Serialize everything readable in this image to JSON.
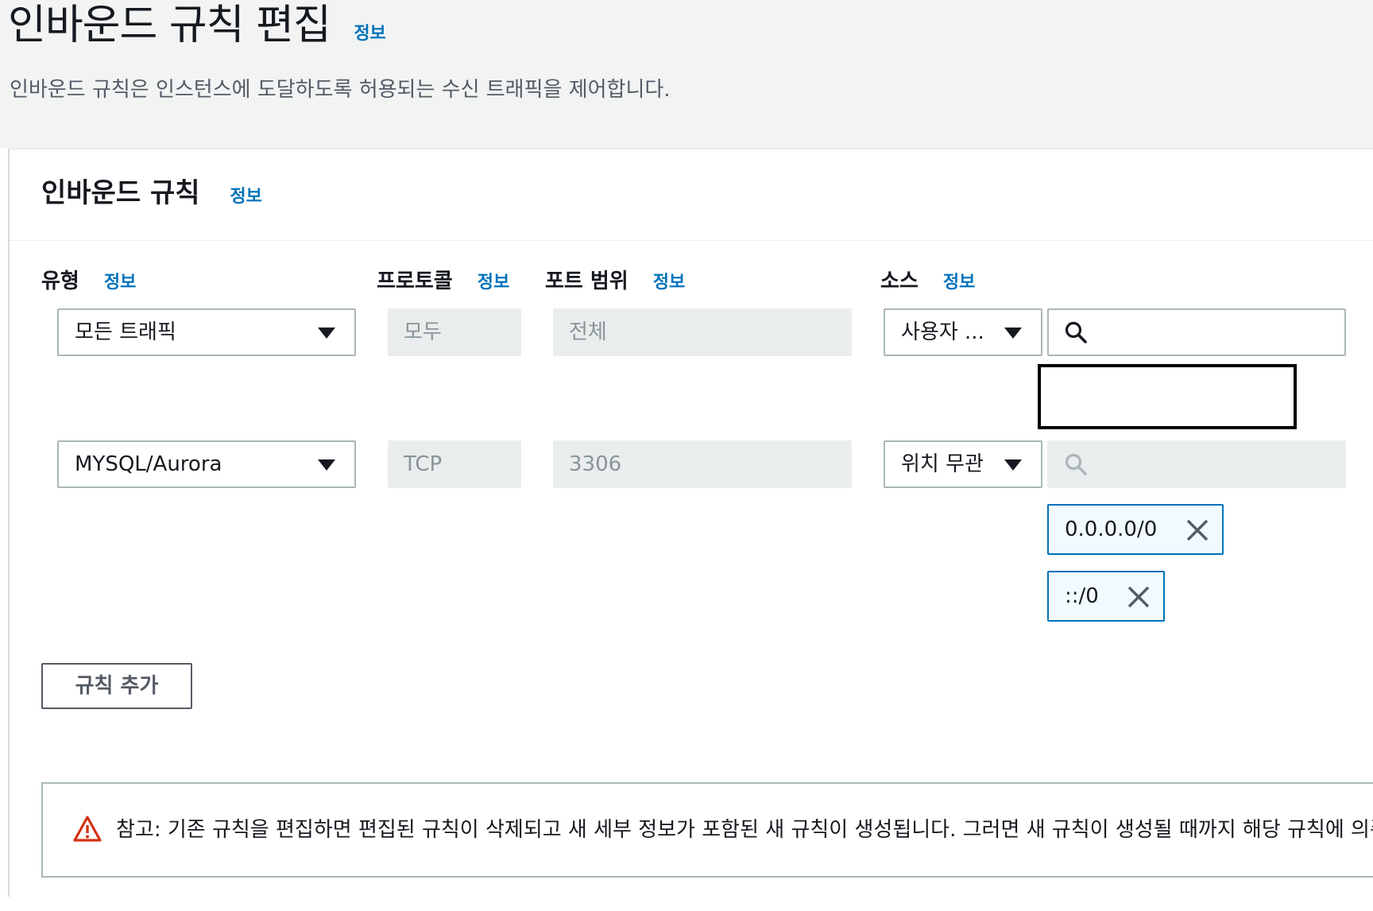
{
  "header": {
    "title": "인바운드 규칙 편집",
    "info": "정보",
    "description": "인바운드 규칙은 인스턴스에 도달하도록 허용되는 수신 트래픽을 제어합니다."
  },
  "panel": {
    "title": "인바운드 규칙",
    "info": "정보"
  },
  "columns": {
    "type": "유형",
    "protocol": "프로토콜",
    "port_range": "포트 범위",
    "source": "소스",
    "info": "정보"
  },
  "rules": [
    {
      "type": "모든 트래픽",
      "protocol": "모두",
      "port": "전체",
      "source_type": "사용자 ...",
      "search_value": "",
      "cidrs": []
    },
    {
      "type": "MYSQL/Aurora",
      "protocol": "TCP",
      "port": "3306",
      "source_type": "위치 무관",
      "search_value": "",
      "cidrs": [
        "0.0.0.0/0",
        "::/0"
      ]
    }
  ],
  "actions": {
    "add_rule": "규칙 추가"
  },
  "alert": {
    "text": "참고: 기존 규칙을 편집하면 편집된 규칙이 삭제되고 새 세부 정보가 포함된 새 규칙이 생성됩니다. 그러면 새 규칙이 생성될 때까지 해당 규칙에 의존"
  },
  "icons": {
    "caret": "caret-down-icon",
    "search": "search-icon",
    "remove": "close-icon",
    "warning": "warning-icon"
  },
  "colors": {
    "link": "#0073bb",
    "warning": "#d13212",
    "token_bg": "#f1faff",
    "disabled_bg": "#eaeded"
  }
}
